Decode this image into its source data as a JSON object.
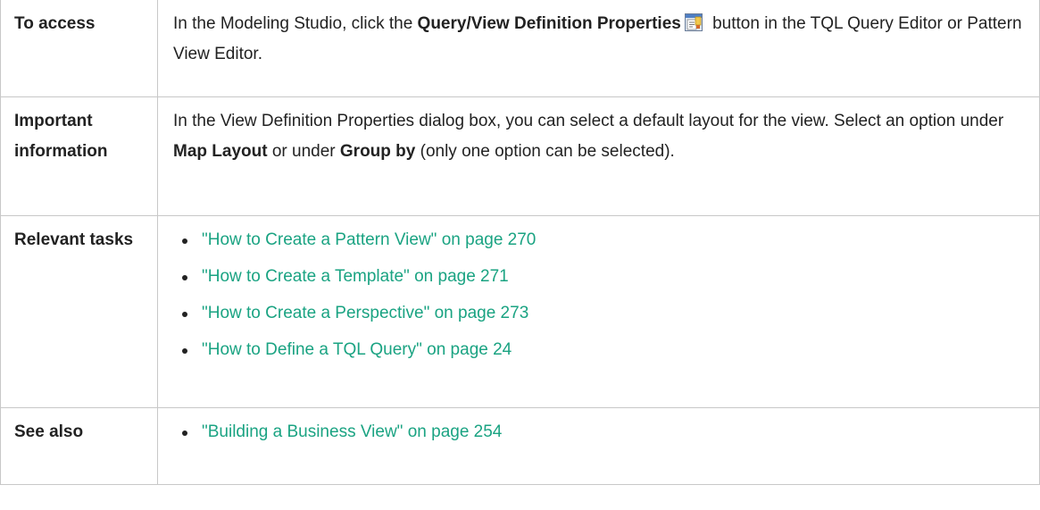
{
  "rows": {
    "access": {
      "label": "To access",
      "text_1": "In the Modeling Studio, click the ",
      "bold_1": "Query/View Definition Properties",
      "icon": "properties-icon",
      "text_2": " button in the TQL Query Editor or Pattern View Editor."
    },
    "important": {
      "label": "Important information",
      "text_1": "In the View Definition Properties dialog box, you can select a default layout for the view. Select an option under ",
      "bold_1": "Map Layout",
      "text_2": " or under ",
      "bold_2": "Group by",
      "text_3": " (only one option can be selected)."
    },
    "tasks": {
      "label": "Relevant tasks",
      "links": [
        "\"How to Create a Pattern View\" on page 270",
        "\"How to Create a Template\" on page 271",
        "\"How to Create a Perspective\" on page 273",
        "\"How to Define a TQL Query\" on page 24"
      ]
    },
    "see_also": {
      "label": "See also",
      "links": [
        "\"Building a Business View\" on page 254"
      ]
    }
  },
  "colors": {
    "link": "#1aa382",
    "border": "#c8c8c8",
    "text": "#222222"
  }
}
